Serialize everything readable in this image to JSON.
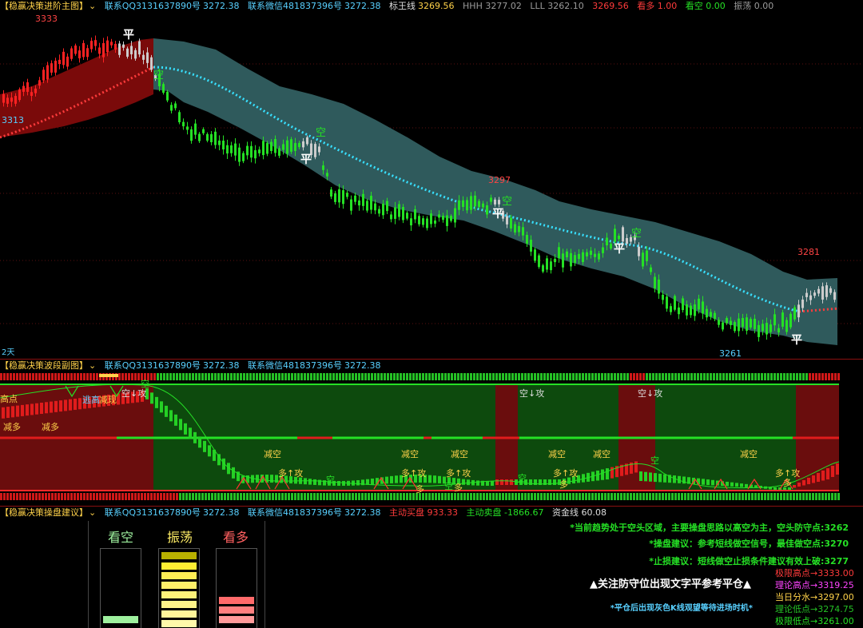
{
  "main_panel": {
    "title": "【稳赢决策进阶主图】",
    "qq": "联系QQ3131637890号",
    "qq_val": "3272.38",
    "wx": "联系微信481837396号",
    "wx_val": "3272.38",
    "biaowang": "标王线",
    "biaowang_val": "3269.56",
    "hhh": "HHH 3277.02",
    "lll": "LLL 3262.10",
    "price_red": "3269.56",
    "kanduo": "看多 1.00",
    "kankong": "看空 0.00",
    "zhendang": "振荡 0.00",
    "labels": {
      "high": "3333",
      "left_price": "3313",
      "mid_high": "3297",
      "right_high": "3281",
      "low": "3261",
      "bottom_left": "2天",
      "ping": "平",
      "kong": "空"
    }
  },
  "wave_panel": {
    "title": "【稳赢决策波段副图】",
    "qq": "联系QQ3131637890号",
    "qq_val": "3272.38",
    "wx": "联系微信481837396号",
    "wx_val": "3272.38",
    "labels": {
      "gaodian": "高点",
      "taogao": "逃高",
      "jianxian": "减现",
      "jianduo": "减多",
      "kong_gong": "空↓攻",
      "jiankong": "减空",
      "duo_gong": "多↑攻",
      "kong": "空",
      "duo": "多",
      "v": "V"
    }
  },
  "ops_panel": {
    "title": "【稳赢决策操盘建议】",
    "qq": "联系QQ3131637890号",
    "qq_val": "3272.38",
    "wx": "联系微信481837396号",
    "wx_val": "3272.38",
    "zhudong_mai": "主动买盘 933.33",
    "zhudong_mai2": "主动卖盘 -1866.67",
    "zijin": "资金线 60.08",
    "gauges": [
      {
        "title": "看空",
        "color": "#9ef09e"
      },
      {
        "title": "振荡",
        "color": "#ffee66"
      },
      {
        "title": "看多",
        "color": "#ff7070"
      }
    ],
    "advice": [
      "*当前趋势处于空头区域，主要操盘思路以高空为主，空头防守点:3262",
      "*操盘建议：参考短线做空信号，最佳做空点:3270",
      "*止损建议：短线做空止损条件建议有效上破:3277",
      "▲关注防守位出现文字平参考平仓▲",
      "*平仓后出现灰色K线观望等待进场时机*"
    ],
    "levels": [
      {
        "text": "极限高点→3333.00",
        "color": "#ff3b3b"
      },
      {
        "text": "理论高点→3319.25",
        "color": "#ff44ff"
      },
      {
        "text": "当日分水→3297.00",
        "color": "#ffd24a"
      },
      {
        "text": "理论低点→3274.75",
        "color": "#25c025"
      },
      {
        "text": "极限低点→3261.00",
        "color": "#25e025"
      }
    ]
  }
}
